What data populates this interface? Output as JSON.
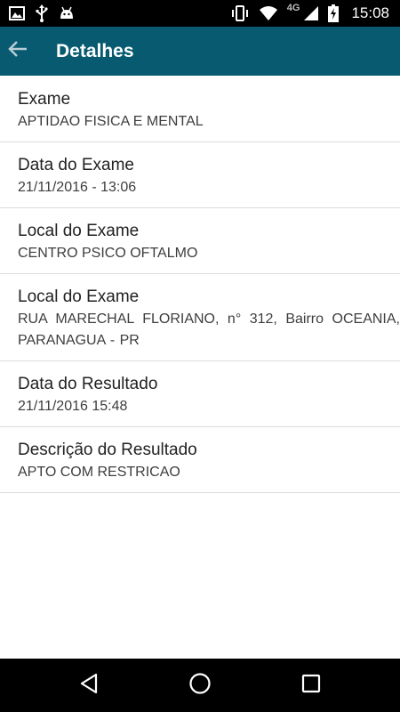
{
  "status_bar": {
    "time": "15:08",
    "network_type": "4G",
    "icons": [
      "image-icon",
      "usb-icon",
      "android-icon",
      "vibrate-icon",
      "wifi-icon",
      "signal-icon",
      "battery-charging-icon"
    ]
  },
  "app_bar": {
    "title": "Detalhes",
    "back_icon": "arrow-back-icon",
    "color": "#075a70"
  },
  "details": [
    {
      "label": "Exame",
      "value": "APTIDAO FISICA E MENTAL"
    },
    {
      "label": "Data do Exame",
      "value": "21/11/2016 - 13:06"
    },
    {
      "label": "Local do Exame",
      "value": "CENTRO PSICO OFTALMO"
    },
    {
      "label": "Local do Exame",
      "value": "RUA MARECHAL FLORIANO, n° 312, Bairro OCEANIA, PARANAGUA - PR"
    },
    {
      "label": "Data do Resultado",
      "value": "21/11/2016 15:48"
    },
    {
      "label": "Descrição do Resultado",
      "value": "APTO COM RESTRICAO"
    }
  ],
  "nav_bar": {
    "icons": [
      "back-triangle-icon",
      "home-circle-icon",
      "recents-square-icon"
    ]
  }
}
